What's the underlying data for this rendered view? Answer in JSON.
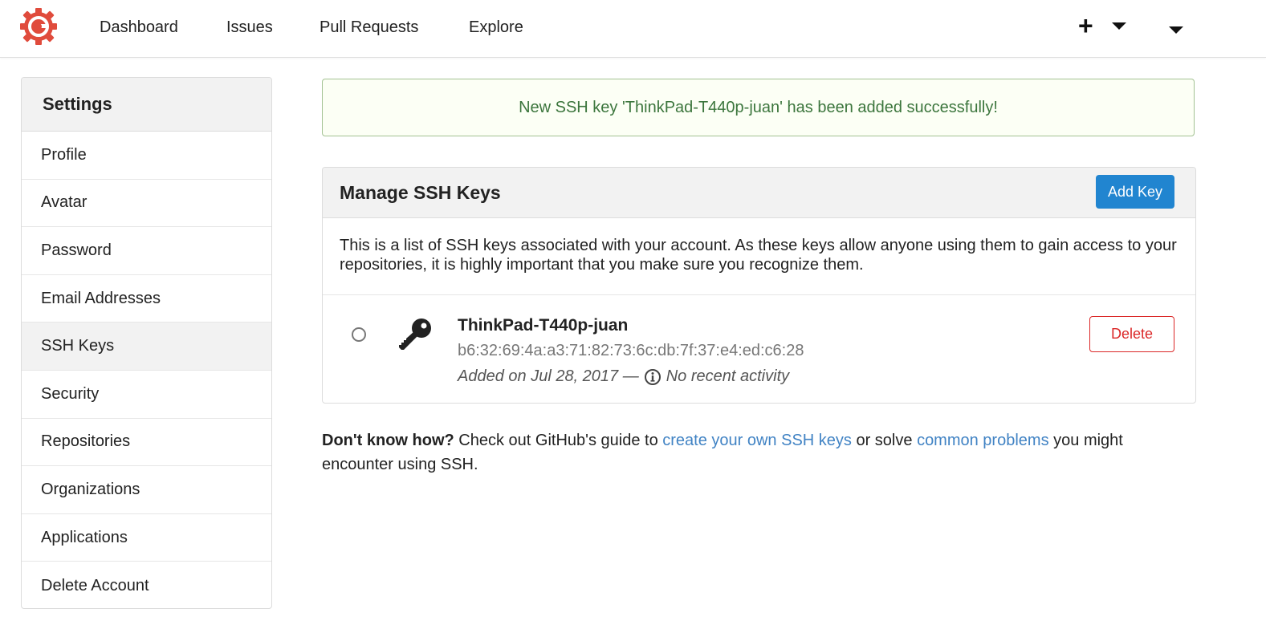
{
  "nav": {
    "items": [
      "Dashboard",
      "Issues",
      "Pull Requests",
      "Explore"
    ],
    "plus": "+"
  },
  "sidebar": {
    "title": "Settings",
    "items": [
      "Profile",
      "Avatar",
      "Password",
      "Email Addresses",
      "SSH Keys",
      "Security",
      "Repositories",
      "Organizations",
      "Applications",
      "Delete Account"
    ],
    "active": "SSH Keys"
  },
  "flash": {
    "message": "New SSH key 'ThinkPad-T440p-juan' has been added successfully!"
  },
  "panel": {
    "title": "Manage SSH Keys",
    "add_label": "Add Key",
    "description": "This is a list of SSH keys associated with your account. As these keys allow anyone using them to gain access to your repositories, it is highly important that you make sure you recognize them."
  },
  "key": {
    "name": "ThinkPad-T440p-juan",
    "fingerprint": "b6:32:69:4a:a3:71:82:73:6c:db:7f:37:e4:ed:c6:28",
    "added": "Added on Jul 28, 2017 —",
    "activity": "No recent activity",
    "delete_label": "Delete"
  },
  "help": {
    "bold": "Don't know how?",
    "text1": " Check out GitHub's guide to ",
    "link1": "create your own SSH keys",
    "text2": " or solve ",
    "link2": "common problems",
    "text3": " you might encounter using SSH."
  },
  "colors": {
    "accent": "#2185d0",
    "danger": "#db2828",
    "success_text": "#3c763d",
    "link": "#4183c4",
    "logo": "#e04b3c"
  },
  "icons": {
    "logo": "gogs-logo-icon",
    "plus": "plus-icon",
    "caret": "caret-down-icon",
    "key": "key-icon",
    "info": "info-circle-icon"
  }
}
